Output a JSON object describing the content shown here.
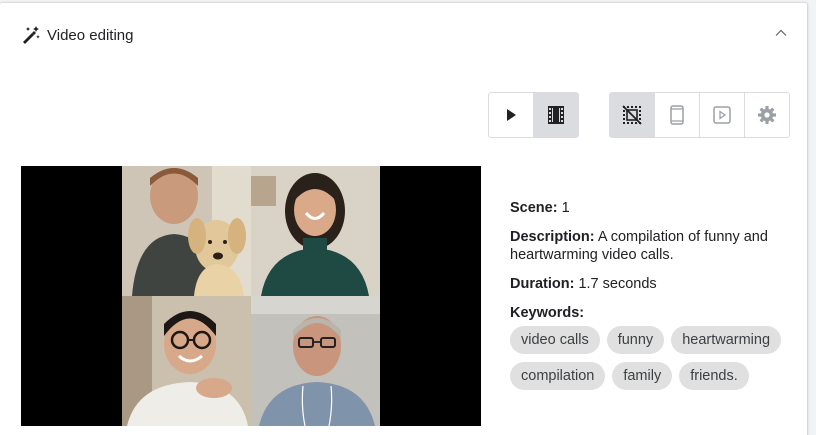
{
  "header": {
    "title": "Video editing",
    "icon": "magic-wand-icon",
    "collapse_icon": "chevron-up-icon"
  },
  "toolbar": {
    "playback": [
      {
        "icon": "play-icon",
        "active": false
      },
      {
        "icon": "film-icon",
        "active": true
      }
    ],
    "view": [
      {
        "icon": "grid-off-icon",
        "active": true
      },
      {
        "icon": "phone-icon",
        "active": false
      },
      {
        "icon": "video-frame-icon",
        "active": false
      },
      {
        "icon": "gear-icon",
        "active": false
      }
    ]
  },
  "scene": {
    "scene_label": "Scene:",
    "scene_value": "1",
    "description_label": "Description:",
    "description_value": "A compilation of funny and heartwarming video calls.",
    "duration_label": "Duration:",
    "duration_value": "1.7 seconds",
    "keywords_label": "Keywords:",
    "keywords": [
      "video calls",
      "funny",
      "heartwarming",
      "compilation",
      "family",
      "friends."
    ]
  },
  "colors": {
    "chip_bg": "#e0e0e0",
    "active_btn_bg": "#dadce0",
    "video_bg": "#000000"
  }
}
